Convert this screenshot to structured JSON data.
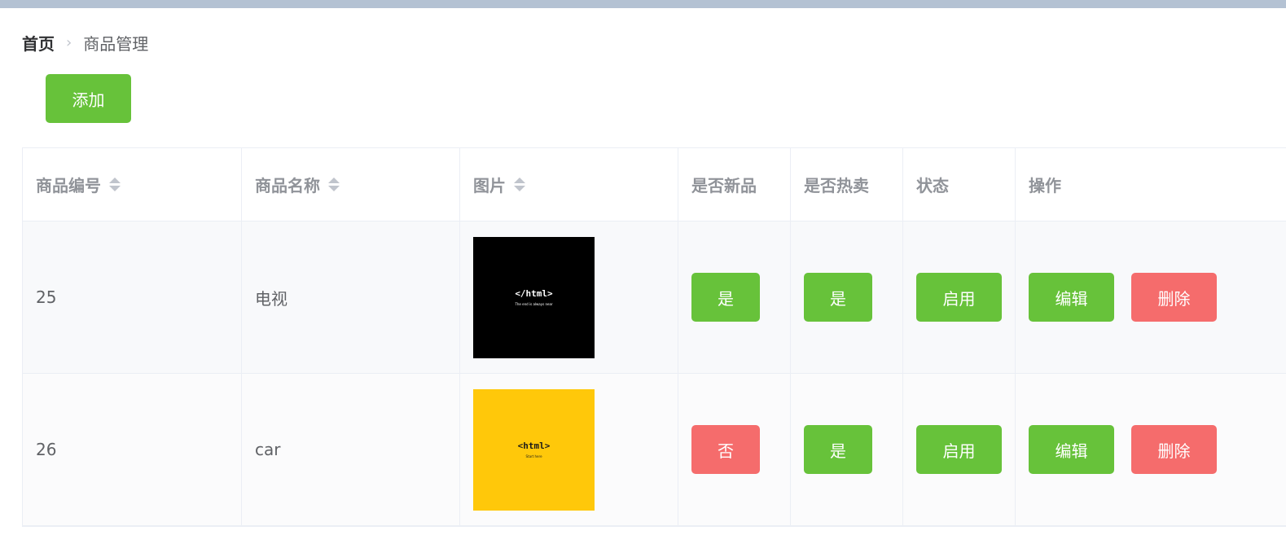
{
  "breadcrumb": {
    "home": "首页",
    "separator": "›",
    "current": "商品管理"
  },
  "toolbar": {
    "add_label": "添加"
  },
  "table": {
    "headers": [
      "商品编号",
      "商品名称",
      "图片",
      "是否新品",
      "是否热卖",
      "状态",
      "操作"
    ],
    "rows": [
      {
        "id": "25",
        "name": "电视",
        "image": {
          "text": "</html>",
          "sub": "The end is always near",
          "bg": "#000000",
          "fg": "#ffffff"
        },
        "is_new": "是",
        "is_new_color": "green",
        "is_hot": "是",
        "is_hot_color": "green",
        "status": "启用",
        "edit": "编辑",
        "delete": "删除"
      },
      {
        "id": "26",
        "name": "car",
        "image": {
          "text": "<html>",
          "sub": "Start here",
          "bg": "#ffc80a",
          "fg": "#1a1a1a"
        },
        "is_new": "否",
        "is_new_color": "red",
        "is_hot": "是",
        "is_hot_color": "green",
        "status": "启用",
        "edit": "编辑",
        "delete": "删除"
      }
    ]
  },
  "colors": {
    "success": "#67c23a",
    "danger": "#f56c6c",
    "topbar": "#b4c2d3"
  }
}
